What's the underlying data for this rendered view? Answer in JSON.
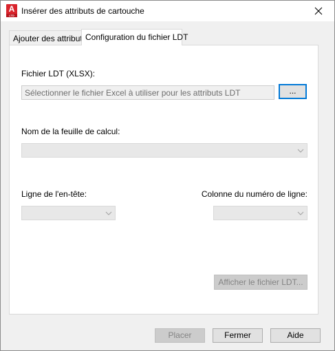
{
  "window": {
    "title": "Insérer des attributs de cartouche",
    "app_icon_letter": "A",
    "app_icon_sub": "LTD"
  },
  "tabs": [
    {
      "label": "Ajouter des attributs",
      "active": false
    },
    {
      "label": "Configuration du fichier LDT",
      "active": true
    }
  ],
  "ldt": {
    "file_label": "Fichier LDT (XLSX):",
    "file_placeholder": "Sélectionner le fichier Excel à utiliser pour les attributs LDT",
    "browse_label": "...",
    "sheet_label": "Nom de la feuille de calcul:",
    "sheet_value": "",
    "header_row_label": "Ligne de l'en-tête:",
    "header_row_value": "",
    "row_number_column_label": "Colonne du numéro de ligne:",
    "row_number_column_value": "",
    "show_file_label": "Afficher le fichier LDT..."
  },
  "footer": {
    "place_label": "Placer",
    "close_label": "Fermer",
    "help_label": "Aide"
  },
  "colors": {
    "accent": "#0078d7",
    "app_icon": "#d9242c"
  }
}
